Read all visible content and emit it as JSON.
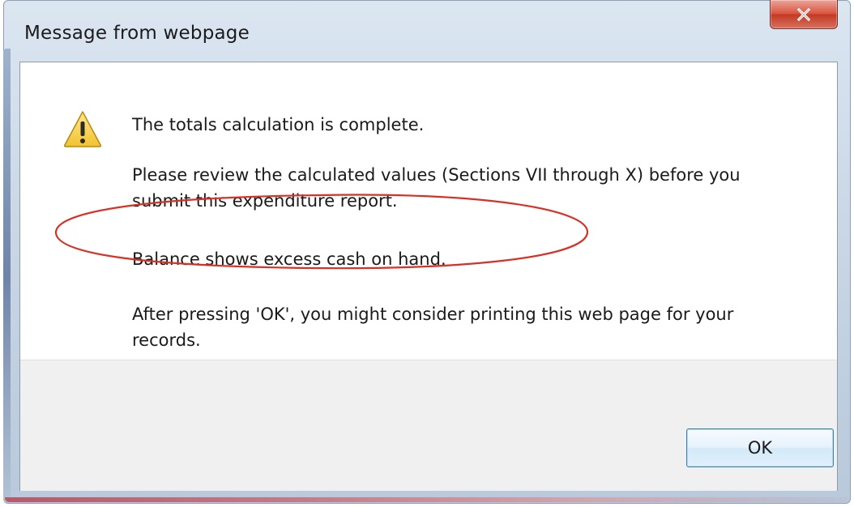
{
  "window": {
    "title": "Message from webpage",
    "close_label": "X"
  },
  "dialog": {
    "icon": "warning-icon",
    "lines": [
      "The totals calculation is complete.",
      "Please review the calculated values (Sections VII through X) before you",
      "submit this expenditure report.",
      "Balance shows excess cash on hand.",
      "After pressing 'OK', you might consider printing this web page for your",
      "records."
    ],
    "annotation": {
      "shape": "ellipse",
      "color": "#d93025",
      "target": "Balance shows excess cash on hand."
    },
    "ok_label": "OK"
  },
  "colors": {
    "close_button": "#d9543f",
    "ok_border": "#3c7fb1",
    "annotation_red": "#d93025",
    "footer_bg": "#f0f0f0"
  }
}
